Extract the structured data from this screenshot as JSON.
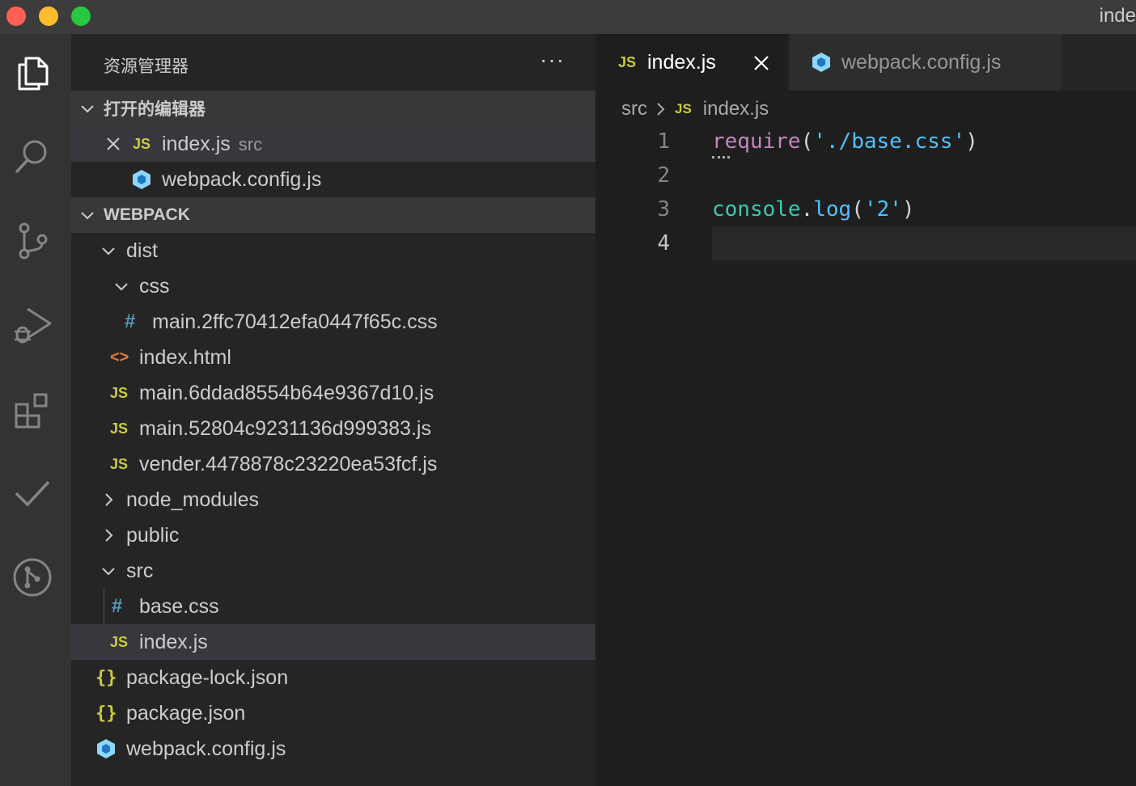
{
  "window": {
    "title": "inde"
  },
  "activity_bar": {
    "items": [
      {
        "name": "explorer",
        "icon": "files-icon"
      },
      {
        "name": "search",
        "icon": "search-icon"
      },
      {
        "name": "source-control",
        "icon": "source-control-icon"
      },
      {
        "name": "run-debug",
        "icon": "debug-icon"
      },
      {
        "name": "extensions",
        "icon": "extensions-icon"
      },
      {
        "name": "check",
        "icon": "checkmark-icon"
      },
      {
        "name": "git-graph",
        "icon": "git-graph-icon"
      }
    ]
  },
  "sidebar": {
    "title": "资源管理器",
    "more": "···",
    "open_editors": {
      "label": "打开的编辑器",
      "items": [
        {
          "label": "index.js",
          "desc": "src",
          "icon": "js"
        },
        {
          "label": "webpack.config.js",
          "icon": "webpack"
        }
      ]
    },
    "project": {
      "label": "WEBPACK",
      "tree": [
        {
          "label": "dist",
          "type": "folder-open"
        },
        {
          "label": "css",
          "type": "folder-open"
        },
        {
          "label": "main.2ffc70412efa0447f65c.css",
          "type": "css"
        },
        {
          "label": "index.html",
          "type": "html"
        },
        {
          "label": "main.6ddad8554b64e9367d10.js",
          "type": "js"
        },
        {
          "label": "main.52804c9231136d999383.js",
          "type": "js"
        },
        {
          "label": "vender.4478878c23220ea53fcf.js",
          "type": "js"
        },
        {
          "label": "node_modules",
          "type": "folder-closed"
        },
        {
          "label": "public",
          "type": "folder-closed"
        },
        {
          "label": "src",
          "type": "folder-open"
        },
        {
          "label": "base.css",
          "type": "css"
        },
        {
          "label": "index.js",
          "type": "js"
        },
        {
          "label": "package-lock.json",
          "type": "json"
        },
        {
          "label": "package.json",
          "type": "json"
        },
        {
          "label": "webpack.config.js",
          "type": "webpack"
        }
      ]
    }
  },
  "editor": {
    "tabs": [
      {
        "label": "index.js",
        "icon": "js",
        "active": true
      },
      {
        "label": "webpack.config.js",
        "icon": "webpack",
        "active": false
      }
    ],
    "breadcrumb": {
      "folder": "src",
      "file": "index.js",
      "file_icon": "JS"
    },
    "lines": [
      {
        "number": "1",
        "tokens": {
          "fn": "require",
          "open": "(",
          "quote1": "'",
          "str": "./base.css",
          "quote2": "'",
          "close": ")"
        }
      },
      {
        "number": "2"
      },
      {
        "number": "3",
        "tokens": {
          "obj": "console",
          "dot": ".",
          "fn": "log",
          "open": "(",
          "quote1": "'",
          "str": "2",
          "quote2": "'",
          "close": ")"
        }
      },
      {
        "number": "4"
      }
    ]
  },
  "icons": {
    "js_text": "JS",
    "css_text": "#",
    "html_text": "<>",
    "json_text": "{}"
  },
  "colors": {
    "js_icon": "#cbcb41",
    "css_icon": "#519aba",
    "html_icon": "#e37933",
    "webpack_icon": "#8ed6fb",
    "keyword": "#c586c0",
    "string": "#4fc1ff"
  }
}
